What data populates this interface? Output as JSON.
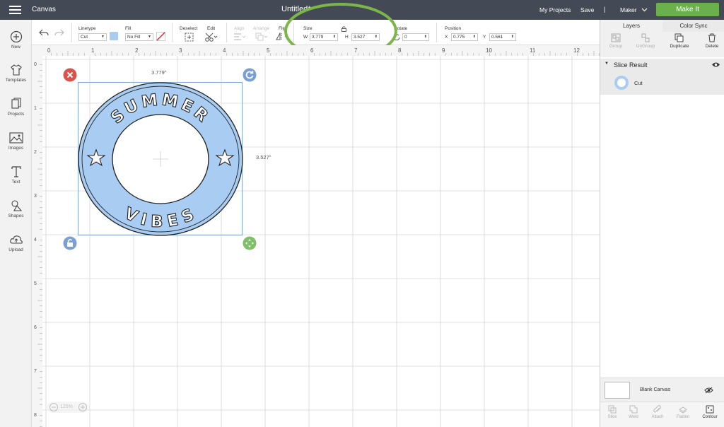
{
  "topbar": {
    "app_label": "Canvas",
    "doc_title": "Untitled*",
    "my_projects": "My Projects",
    "save": "Save",
    "separator": "|",
    "machine": "Maker",
    "make_it": "Make It"
  },
  "toolbar": {
    "linetype_label": "Linetype",
    "linetype_value": "Cut",
    "fill_label": "Fill",
    "fill_value": "No Fill",
    "fill_color": "#a9cdf2",
    "deselect_label": "Deselect",
    "edit_label": "Edit",
    "align_label": "Align",
    "arrange_label": "Arrange",
    "flip_label": "Flip",
    "size_label": "Size",
    "w_label": "W",
    "w_value": "3.779",
    "h_label": "H",
    "h_value": "3.527",
    "rotate_label": "Rotate",
    "rotate_value": "0",
    "position_label": "Position",
    "x_label": "X",
    "x_value": "0.775",
    "y_label": "Y",
    "y_value": "0.561"
  },
  "sidebar": {
    "items": [
      {
        "label": "New",
        "icon": "plus-circle-icon"
      },
      {
        "label": "Templates",
        "icon": "tshirt-icon"
      },
      {
        "label": "Projects",
        "icon": "projects-icon"
      },
      {
        "label": "Images",
        "icon": "image-icon"
      },
      {
        "label": "Text",
        "icon": "text-icon"
      },
      {
        "label": "Shapes",
        "icon": "shapes-icon"
      },
      {
        "label": "Upload",
        "icon": "upload-cloud-icon"
      }
    ]
  },
  "canvas": {
    "ruler_top": [
      "0",
      "1",
      "2",
      "3",
      "4",
      "5",
      "6",
      "7",
      "8",
      "9",
      "10",
      "11",
      "12"
    ],
    "ruler_left": [
      "0",
      "1",
      "2",
      "3",
      "4",
      "5",
      "6",
      "7",
      "8"
    ],
    "width_dim": "3.779\"",
    "height_dim": "3.527\"",
    "design_top_text": "SUMMER",
    "design_bottom_text": "VIBES",
    "design_color": "#a9cdf2",
    "zoom": "125%"
  },
  "right_panel": {
    "tab_layers": "Layers",
    "tab_color_sync": "Color Sync",
    "group": "Group",
    "ungroup": "UnGroup",
    "duplicate": "Duplicate",
    "delete": "Delete",
    "slice_result": "Slice Result",
    "layer_cut": "Cut",
    "blank_canvas": "Blank Canvas",
    "bottom": [
      "Slice",
      "Weld",
      "Attach",
      "Flatten",
      "Contour"
    ]
  },
  "colors": {
    "topbar": "#434a55",
    "make_it": "#6ab04c",
    "highlight": "#7ab648",
    "rotate_handle": "#7a9fd4",
    "scale_handle": "#7fbf6a",
    "delete_handle": "#d9534f"
  }
}
